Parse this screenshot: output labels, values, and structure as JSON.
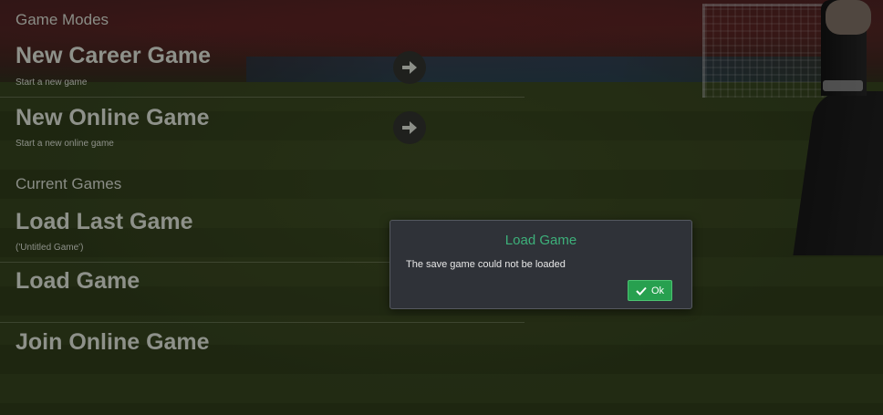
{
  "menu": {
    "game_modes_header": "Game Modes",
    "current_games_header": "Current Games",
    "items": [
      {
        "title": "New Career Game",
        "subtitle": "Start a new game",
        "icon": "arrow-right-icon"
      },
      {
        "title": "New Online Game",
        "subtitle": "Start a new online game",
        "icon": "arrow-right-icon"
      },
      {
        "title": "Load Last Game",
        "subtitle": "('Untitled Game')"
      },
      {
        "title": "Load Game",
        "subtitle": ""
      },
      {
        "title": "Join Online Game",
        "subtitle": ""
      }
    ]
  },
  "dialog": {
    "title": "Load Game",
    "message": "The save game could not be loaded",
    "ok_label": "Ok",
    "ok_icon": "checkmark-icon"
  },
  "colors": {
    "accent_title": "#3db07a",
    "ok_button": "#27a04f",
    "menu_text": "#8e918a"
  }
}
